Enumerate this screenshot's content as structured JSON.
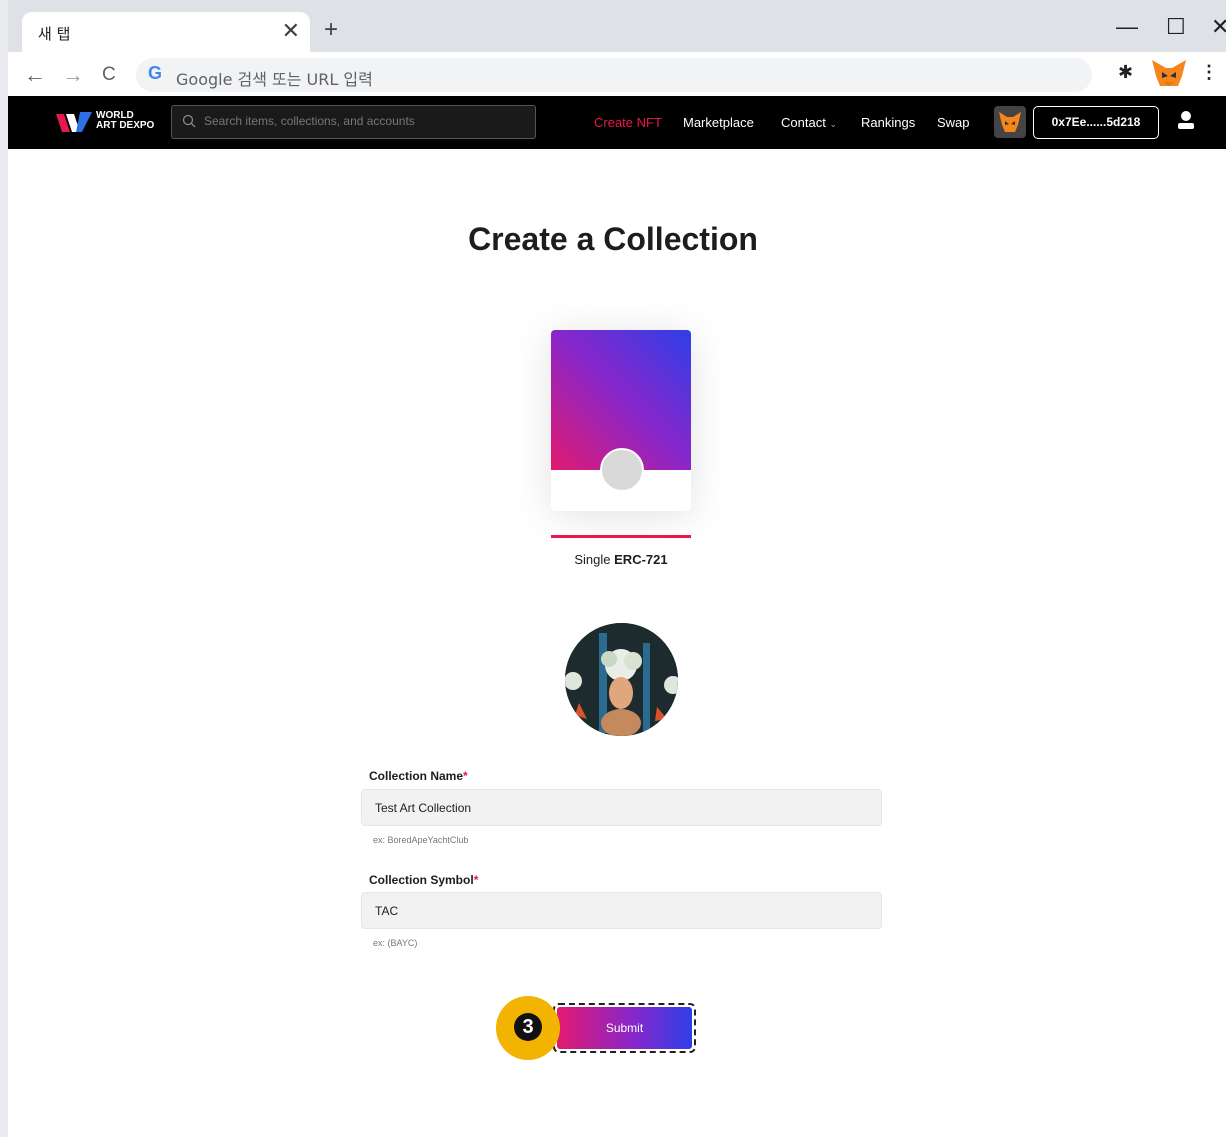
{
  "browser": {
    "tab_title": "새 탭",
    "tab_close": "✕",
    "new_tab": "+",
    "omnibox_placeholder": "Google 검색 또는 URL 입력",
    "google_logo": "G",
    "window_controls": {
      "minimize": "—",
      "maximize": "☐",
      "close": "✕"
    },
    "nav": {
      "back": "←",
      "forward": "→",
      "reload": "C"
    }
  },
  "site": {
    "logo_text_line1": "WORLD",
    "logo_text_line2": "ART DEXPO",
    "search_placeholder": "Search items, collections, and accounts",
    "nav_links": [
      "Create NFT",
      "Marketplace",
      "Contact",
      "Rankings",
      "Swap"
    ],
    "contact_chevron": "⌄",
    "wallet_address": "0x7Ee......5d218",
    "accent_color": "#e8184f"
  },
  "main": {
    "title": "Create a Collection",
    "card_label_prefix": "Single",
    "card_label_bold": "ERC-721",
    "fields": {
      "name_label": "Collection Name",
      "name_value": "Test Art Collection",
      "name_hint": "ex: BoredApeYachtClub",
      "symbol_label": "Collection Symbol",
      "symbol_value": "TAC",
      "symbol_hint": "ex: (BAYC)",
      "required_mark": "*"
    },
    "submit_label": "Submit",
    "step_number": "3"
  }
}
